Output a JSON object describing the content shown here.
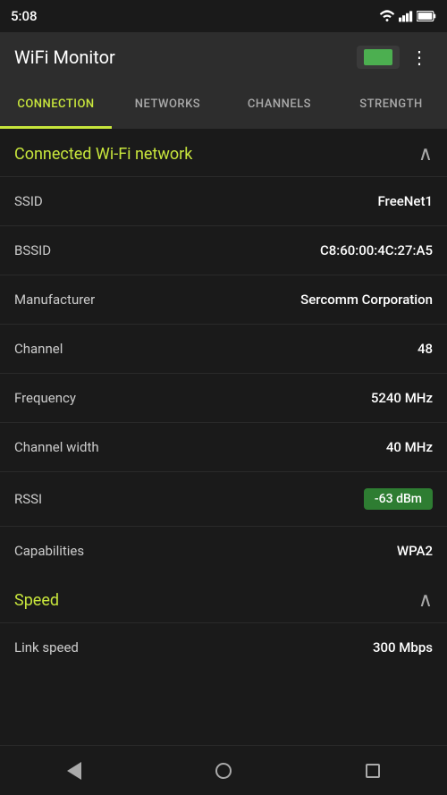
{
  "status_bar": {
    "time": "5:08"
  },
  "app_bar": {
    "title": "WiFi Monitor"
  },
  "tabs": [
    {
      "label": "CONNECTION",
      "active": true
    },
    {
      "label": "NETWORKS",
      "active": false
    },
    {
      "label": "CHANNELS",
      "active": false
    },
    {
      "label": "STRENGTH",
      "active": false
    }
  ],
  "connected_section": {
    "title": "Connected Wi-Fi network",
    "rows": [
      {
        "label": "SSID",
        "value": "FreeNet1"
      },
      {
        "label": "BSSID",
        "value": "C8:60:00:4C:27:A5"
      },
      {
        "label": "Manufacturer",
        "value": "Sercomm Corporation"
      },
      {
        "label": "Channel",
        "value": "48"
      },
      {
        "label": "Frequency",
        "value": "5240 MHz"
      },
      {
        "label": "Channel width",
        "value": "40 MHz"
      },
      {
        "label": "RSSI",
        "value": "-63 dBm",
        "badge": true
      },
      {
        "label": "Capabilities",
        "value": "WPA2"
      }
    ]
  },
  "speed_section": {
    "title": "Speed",
    "rows": [
      {
        "label": "Link speed",
        "value": "300 Mbps"
      }
    ]
  }
}
